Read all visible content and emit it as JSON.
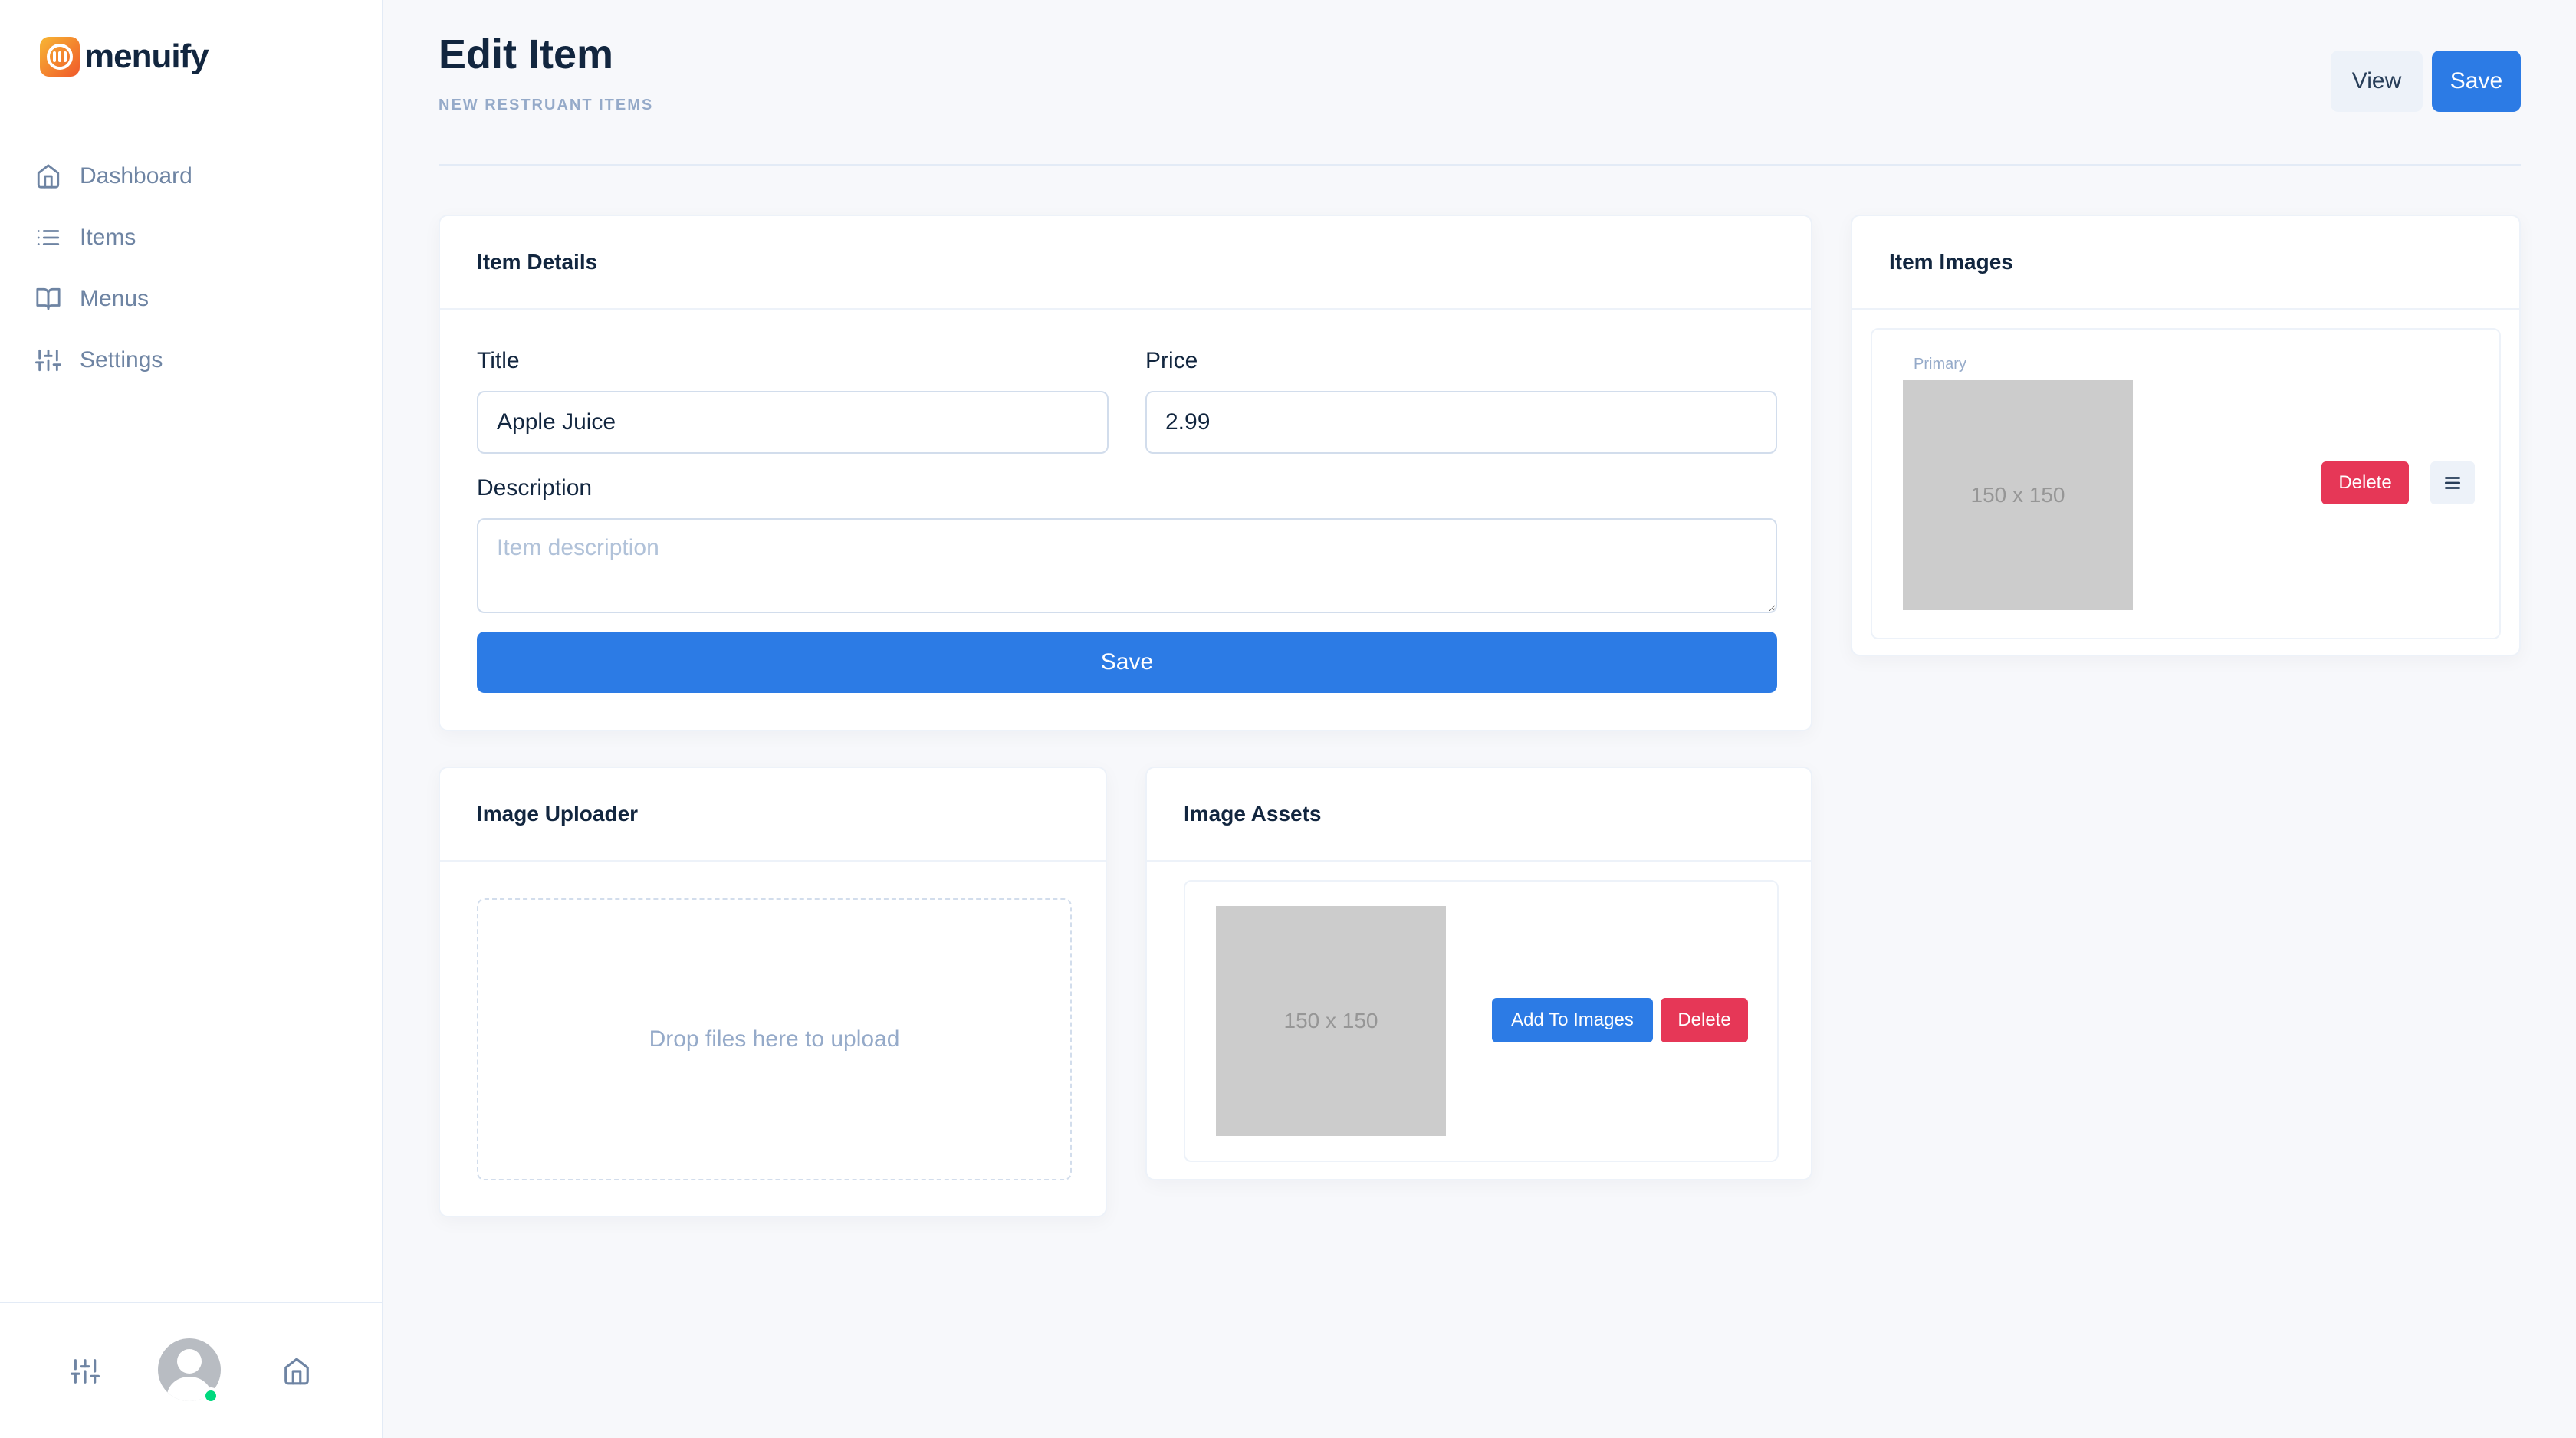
{
  "brand": {
    "name": "menuify"
  },
  "sidebar": {
    "items": [
      {
        "label": "Dashboard",
        "icon": "home-icon"
      },
      {
        "label": "Items",
        "icon": "list-icon"
      },
      {
        "label": "Menus",
        "icon": "book-open-icon"
      },
      {
        "label": "Settings",
        "icon": "sliders-icon"
      }
    ],
    "footer": {
      "left_icon": "sliders-icon",
      "right_icon": "home-icon",
      "status": "online"
    }
  },
  "header": {
    "title": "Edit Item",
    "pretitle": "New Restruant Items",
    "view_label": "View",
    "save_label": "Save"
  },
  "item_details": {
    "title": "Item Details",
    "title_label": "Title",
    "title_value": "Apple Juice",
    "price_label": "Price",
    "price_value": "2.99",
    "description_label": "Description",
    "description_placeholder": "Item description",
    "save_label": "Save"
  },
  "item_images": {
    "title": "Item Images",
    "primary_label": "Primary",
    "image_placeholder": "150 x 150",
    "delete_label": "Delete"
  },
  "image_uploader": {
    "title": "Image Uploader",
    "dropzone_text": "Drop files here to upload"
  },
  "image_assets": {
    "title": "Image Assets",
    "image_placeholder": "150 x 150",
    "add_label": "Add To Images",
    "delete_label": "Delete"
  },
  "colors": {
    "primary": "#2c7be5",
    "danger": "#e63757",
    "success": "#00d97e",
    "muted": "#95aac9"
  }
}
